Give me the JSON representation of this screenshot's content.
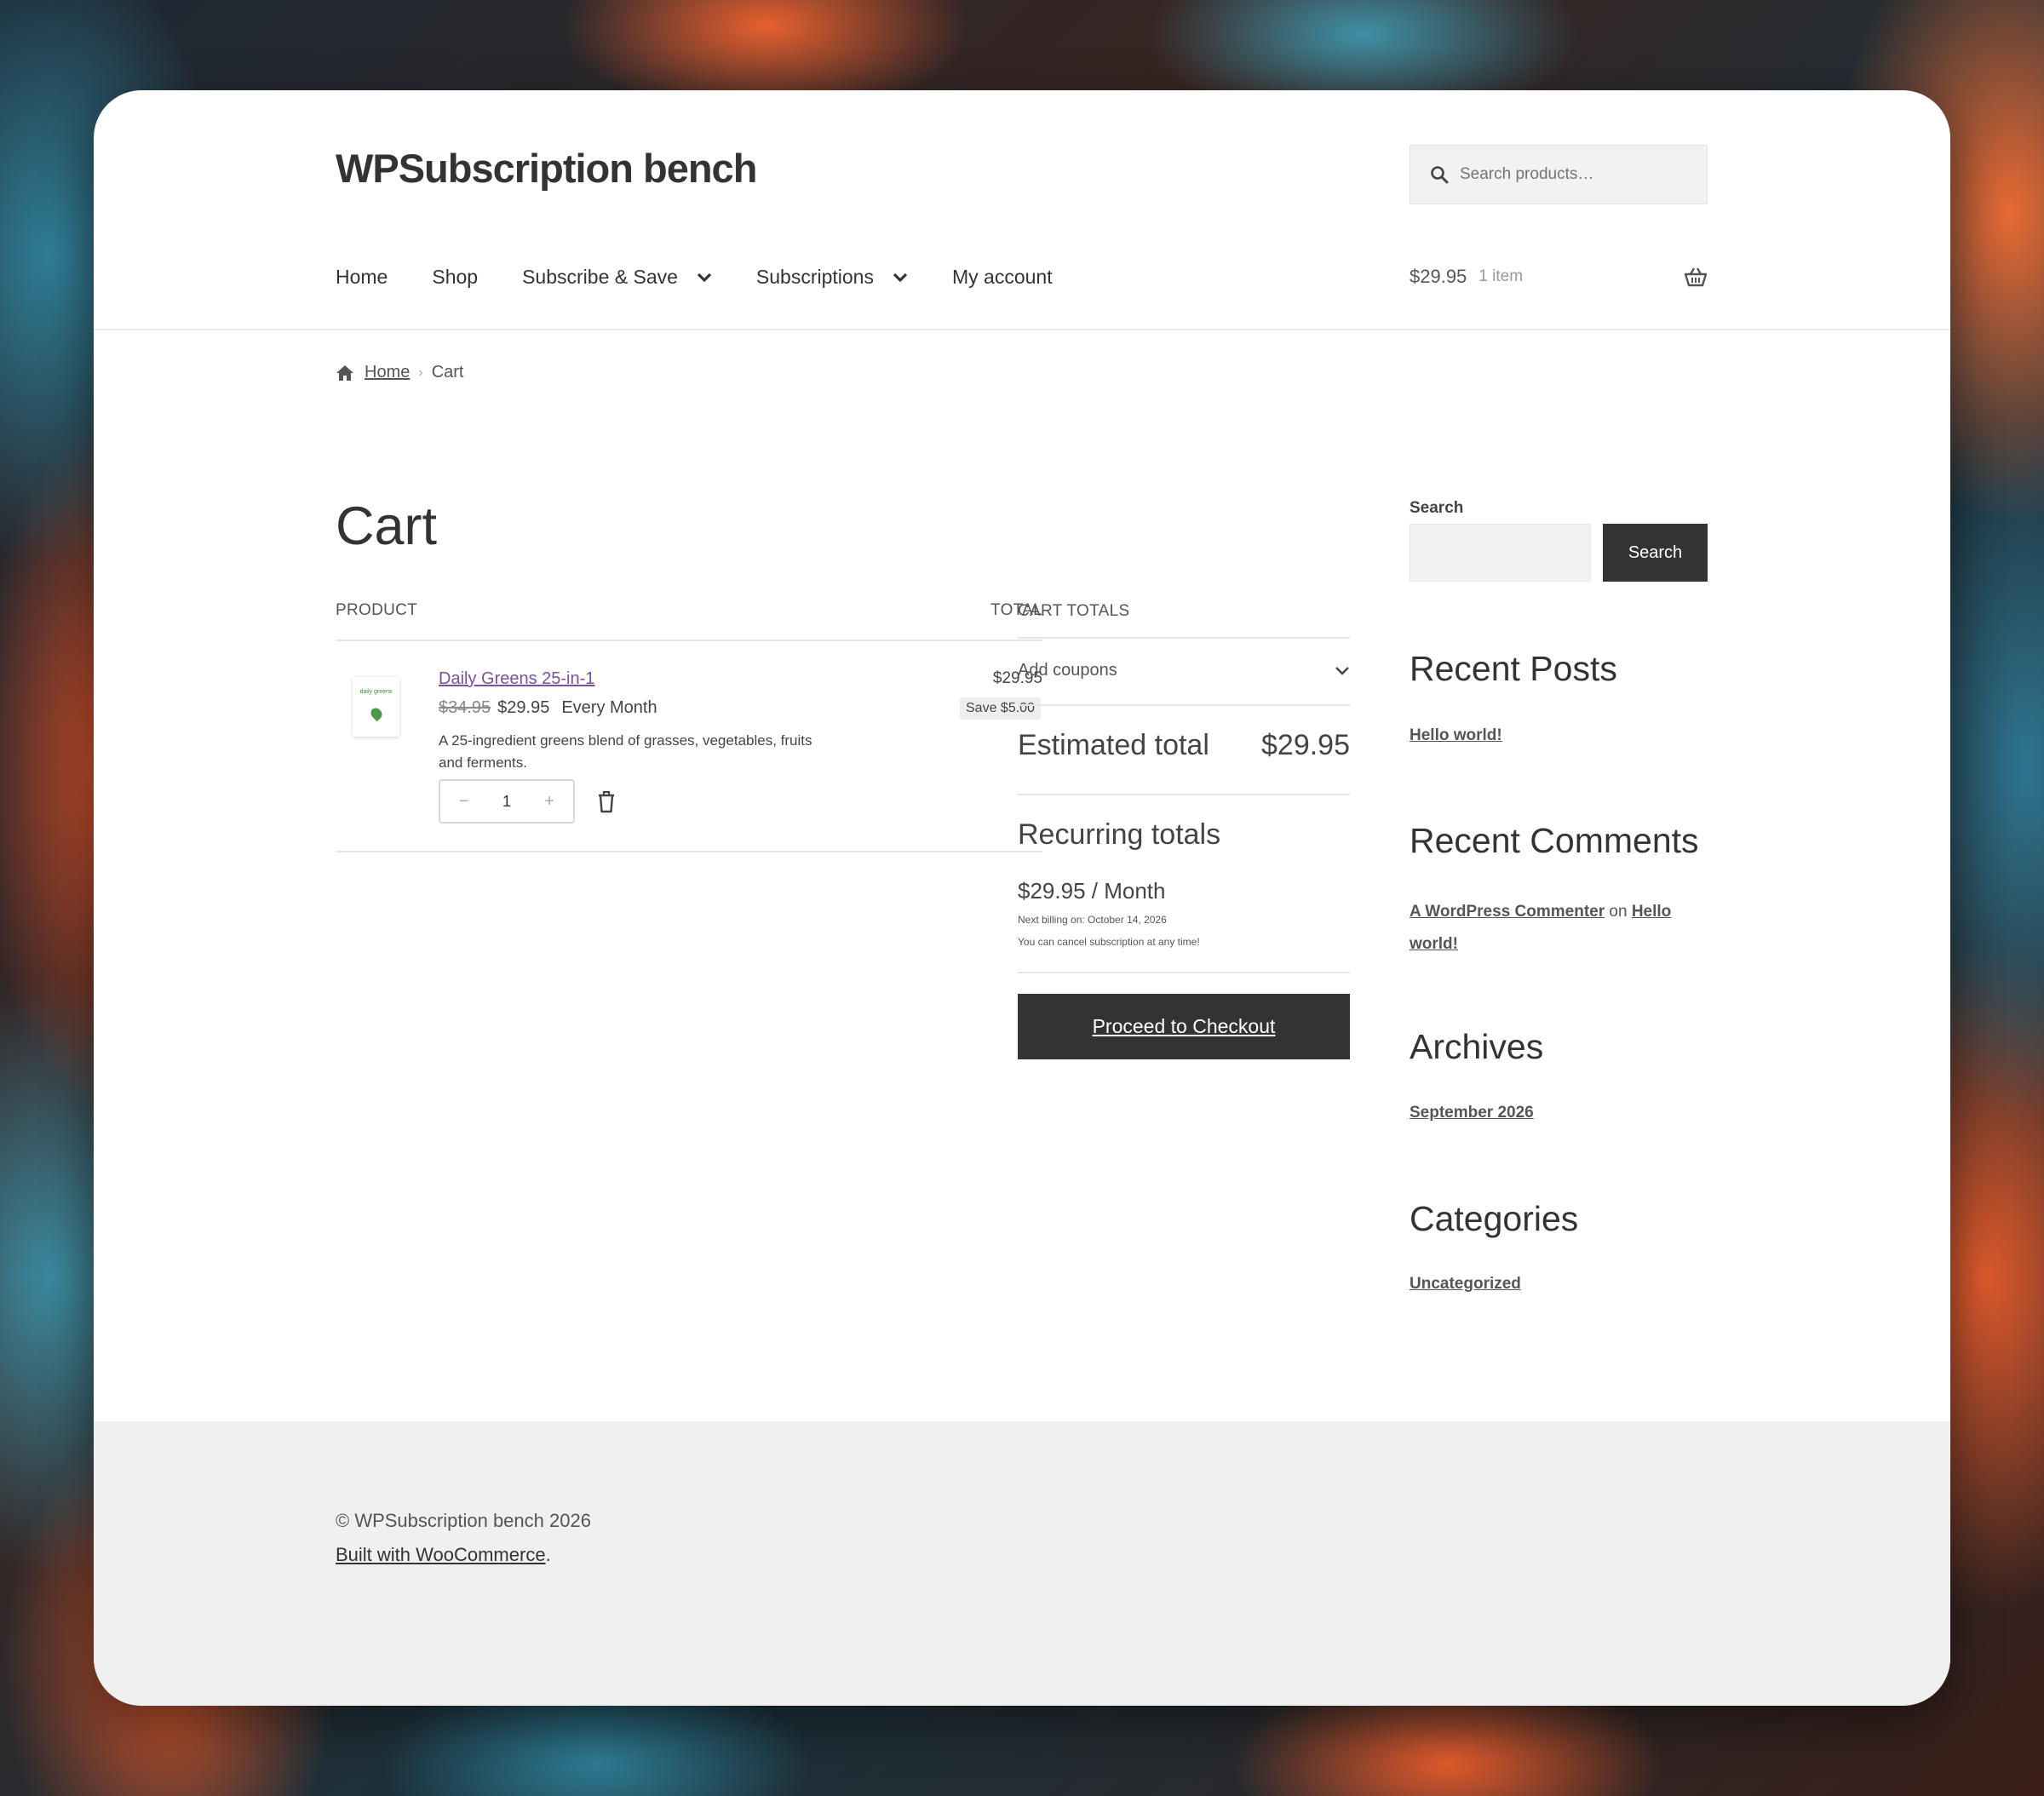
{
  "site": {
    "title": "WPSubscription bench"
  },
  "header_search": {
    "placeholder": "Search products…"
  },
  "nav": {
    "items": [
      {
        "label": "Home"
      },
      {
        "label": "Shop"
      },
      {
        "label": "Subscribe & Save",
        "dropdown": true
      },
      {
        "label": "Subscriptions",
        "dropdown": true
      },
      {
        "label": "My account"
      }
    ]
  },
  "mini_cart": {
    "amount": "$29.95",
    "count": "1 item"
  },
  "breadcrumb": {
    "home": "Home",
    "current": "Cart"
  },
  "cart": {
    "title": "Cart",
    "col_product": "PRODUCT",
    "col_total": "TOTAL",
    "item": {
      "thumb_label": "daily greens",
      "name": "Daily Greens 25-in-1",
      "old_price": "$34.95",
      "price": "$29.95",
      "period": "Every Month",
      "description": "A 25-ingredient greens blend of grasses, vegetables, fruits and ferments.",
      "qty_minus": "−",
      "qty": "1",
      "qty_plus": "+",
      "line_total": "$29.95",
      "save": "Save $5.00"
    }
  },
  "totals": {
    "heading": "CART TOTALS",
    "coupons": "Add coupons",
    "estimated_label": "Estimated total",
    "estimated_value": "$29.95",
    "recurring_heading": "Recurring totals",
    "recurring_price": "$29.95 / Month",
    "next_billing": "Next billing on: October 14, 2026",
    "cancel_note": "You can cancel subscription at any time!",
    "checkout": "Proceed to Checkout"
  },
  "sidebar": {
    "search_label": "Search",
    "search_button": "Search",
    "recent_posts_title": "Recent Posts",
    "recent_post": "Hello world!",
    "recent_comments_title": "Recent Comments",
    "comment_author": "A WordPress Commenter",
    "comment_on": "on",
    "comment_post": "Hello world!",
    "archives_title": "Archives",
    "archive": "September 2026",
    "categories_title": "Categories",
    "category": "Uncategorized"
  },
  "footer": {
    "copyright": "© WPSubscription bench 2026",
    "built_link": "Built with WooCommerce",
    "built_suffix": "."
  },
  "colors": {
    "link_purple": "#7b4f9e",
    "button_dark": "#333333"
  }
}
